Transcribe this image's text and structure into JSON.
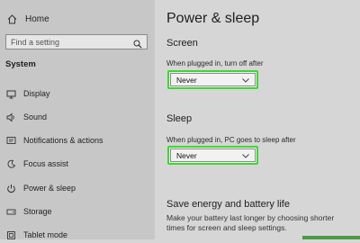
{
  "sidebar": {
    "home_label": "Home",
    "search_placeholder": "Find a setting",
    "section_label": "System",
    "items": [
      {
        "label": "Display",
        "icon": "display-icon"
      },
      {
        "label": "Sound",
        "icon": "sound-icon"
      },
      {
        "label": "Notifications & actions",
        "icon": "notifications-icon"
      },
      {
        "label": "Focus assist",
        "icon": "focus-assist-icon"
      },
      {
        "label": "Power & sleep",
        "icon": "power-icon"
      },
      {
        "label": "Storage",
        "icon": "storage-icon"
      },
      {
        "label": "Tablet mode",
        "icon": "tablet-mode-icon"
      }
    ]
  },
  "main": {
    "title": "Power & sleep",
    "screen": {
      "heading": "Screen",
      "label": "When plugged in, turn off after",
      "value": "Never"
    },
    "sleep": {
      "heading": "Sleep",
      "label": "When plugged in, PC goes to sleep after",
      "value": "Never"
    },
    "energy": {
      "heading": "Save energy and battery life",
      "description_line1": "Make your battery last longer by choosing shorter",
      "description_line2": "times for screen and sleep settings."
    }
  },
  "colors": {
    "highlight": "#3bd92f",
    "sidebar_bg": "#c7c7c7",
    "main_bg": "#d6d6d6"
  }
}
